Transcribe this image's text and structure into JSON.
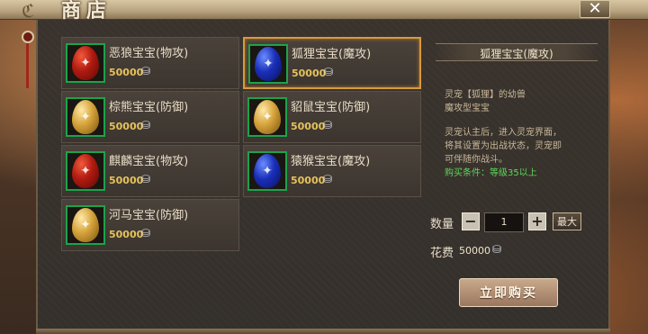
{
  "window": {
    "title": "商店",
    "close_label": "✕"
  },
  "items": [
    {
      "name": "恶狼宝宝(物攻)",
      "price": "50000",
      "egg": "red",
      "icon": "wolf-icon",
      "selected": false
    },
    {
      "name": "狐狸宝宝(魔攻)",
      "price": "50000",
      "egg": "blue",
      "icon": "fox-icon",
      "selected": true
    },
    {
      "name": "棕熊宝宝(防御)",
      "price": "50000",
      "egg": "gold",
      "icon": "bear-icon",
      "selected": false
    },
    {
      "name": "貂鼠宝宝(防御)",
      "price": "50000",
      "egg": "gold",
      "icon": "marten-icon",
      "selected": false
    },
    {
      "name": "麒麟宝宝(物攻)",
      "price": "50000",
      "egg": "red",
      "icon": "qilin-icon",
      "selected": false
    },
    {
      "name": "猿猴宝宝(魔攻)",
      "price": "50000",
      "egg": "blue",
      "icon": "ape-icon",
      "selected": false
    },
    {
      "name": "河马宝宝(防御)",
      "price": "50000",
      "egg": "gold",
      "icon": "hippo-icon",
      "selected": false
    }
  ],
  "detail": {
    "title": "狐狸宝宝(魔攻)",
    "line1": "灵宠【狐狸】的幼兽",
    "line2": "魔攻型宝宝",
    "line3": "灵宠认主后，进入灵宠界面，",
    "line4": "将其设置为出战状态，灵宠即",
    "line5": "可伴随你战斗。",
    "requirement": "购买条件：等级35以上"
  },
  "purchase": {
    "qty_label": "数量",
    "minus": "−",
    "qty_value": "1",
    "plus": "+",
    "max_label": "最大",
    "cost_label": "花费",
    "cost_value": "50000",
    "buy_label": "立即购买"
  },
  "icons": {
    "coin": "silver-ingot-icon",
    "close": "close-icon"
  },
  "colors": {
    "selected_border": "#d79a3e",
    "frame_green": "#1ea24a",
    "price_gold": "#e6c25a",
    "requirement_green": "#5ed65a"
  }
}
